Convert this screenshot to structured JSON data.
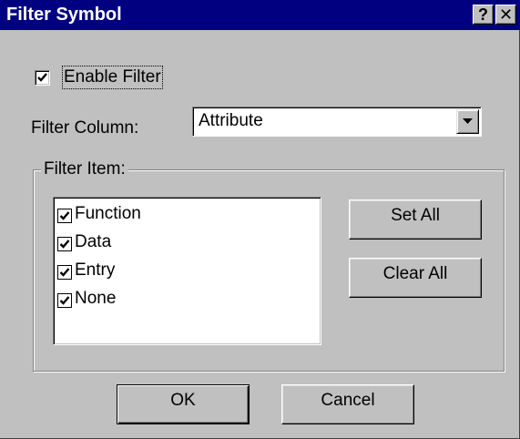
{
  "window": {
    "title": "Filter Symbol",
    "help_label": "?",
    "close_label": "✕"
  },
  "enable_filter": {
    "label": "Enable Filter",
    "checked": true
  },
  "filter_column": {
    "label": "Filter Column:",
    "value": "Attribute"
  },
  "filter_item": {
    "label": "Filter Item:",
    "items": [
      {
        "label": "Function",
        "checked": true
      },
      {
        "label": "Data",
        "checked": true
      },
      {
        "label": "Entry",
        "checked": true
      },
      {
        "label": "None",
        "checked": true
      }
    ]
  },
  "buttons": {
    "set_all": "Set All",
    "clear_all": "Clear All",
    "ok": "OK",
    "cancel": "Cancel"
  }
}
